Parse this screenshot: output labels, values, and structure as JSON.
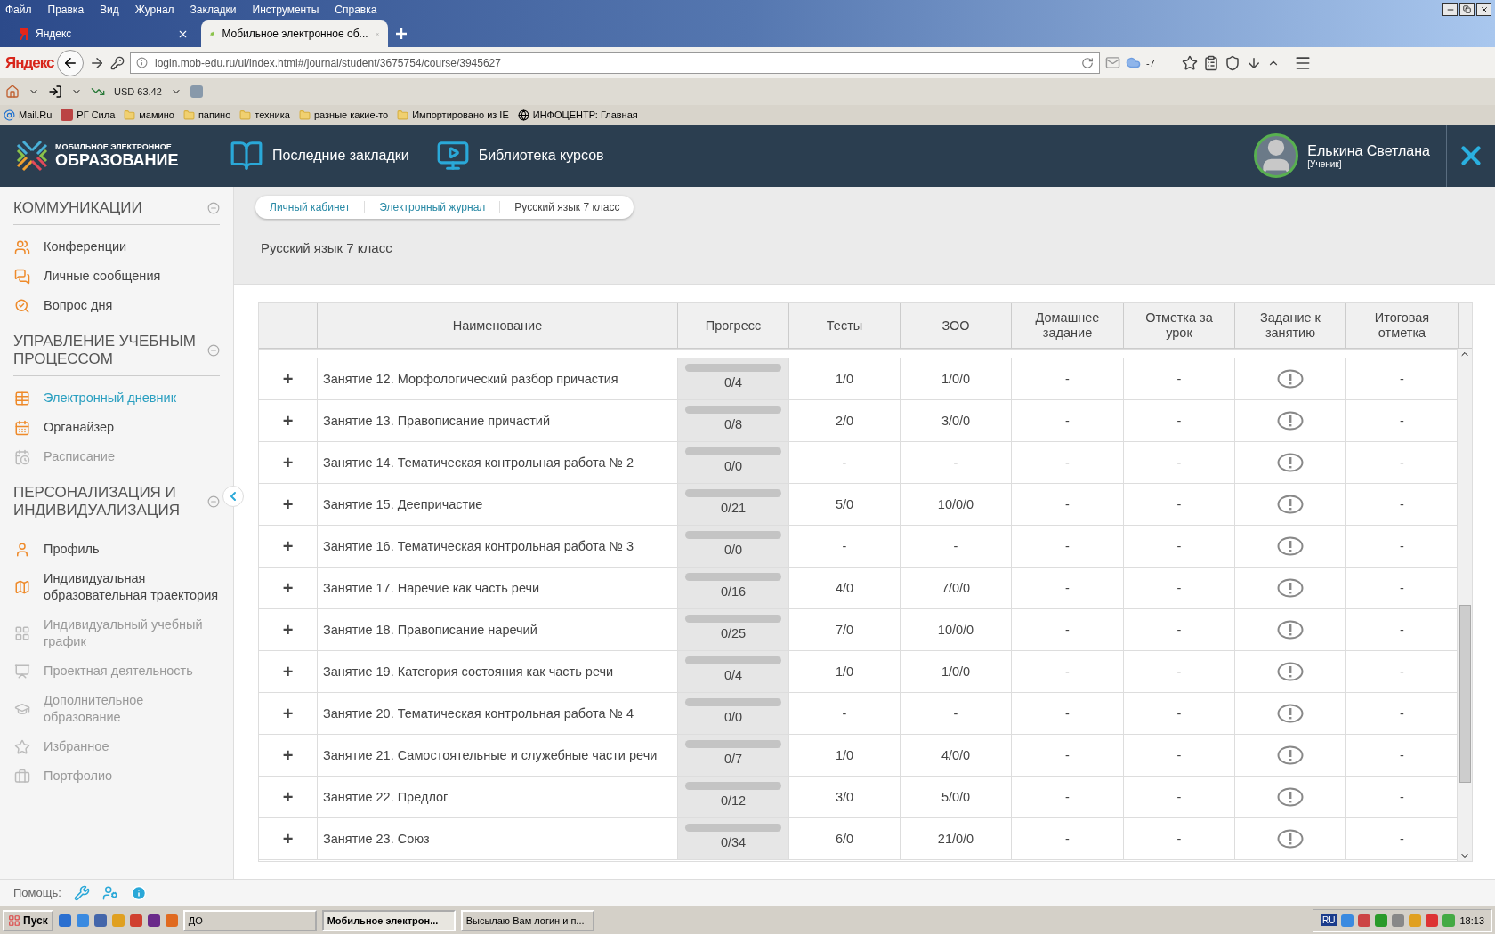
{
  "browser": {
    "menu": [
      "Файл",
      "Правка",
      "Вид",
      "Журнал",
      "Закладки",
      "Инструменты",
      "Справка"
    ],
    "tabs": [
      {
        "label": "Яндекс",
        "selected": false
      },
      {
        "label": "Мобильное электронное об...",
        "selected": true
      }
    ],
    "brand": "Яндекс",
    "address": "login.mob-edu.ru/ui/index.html#/journal/student/3675754/course/3945627",
    "weather": "-7",
    "currency": "USD 63.42",
    "bookmarks": [
      "Mail.Ru",
      "РГ Сила",
      "мамино",
      "папино",
      "техника",
      "разные какие-то",
      "Импортировано из IE",
      "ИНФОЦЕНТР: Главная"
    ]
  },
  "header": {
    "logo_top": "МОБИЛЬНОЕ ЭЛЕКТРОННОЕ",
    "logo_bottom": "ОБРАЗОВАНИЕ",
    "nav": [
      "Последние закладки",
      "Библиотека курсов"
    ],
    "user": {
      "name": "Елькина Светлана",
      "role": "[Ученик]"
    }
  },
  "sidebar": [
    {
      "title": "КОММУНИКАЦИИ",
      "expanded": true,
      "items": [
        {
          "label": "Конференции",
          "selected": false,
          "disabled": false
        },
        {
          "label": "Личные сообщения",
          "selected": false,
          "disabled": false
        },
        {
          "label": "Вопрос дня",
          "selected": false,
          "disabled": false
        }
      ]
    },
    {
      "title": "УПРАВЛЕНИЕ УЧЕБНЫМ ПРОЦЕССОМ",
      "expanded": true,
      "items": [
        {
          "label": "Электронный дневник",
          "selected": true,
          "disabled": false
        },
        {
          "label": "Органайзер",
          "selected": false,
          "disabled": false
        },
        {
          "label": "Расписание",
          "selected": false,
          "disabled": true
        }
      ]
    },
    {
      "title": "ПЕРСОНАЛИЗАЦИЯ И ИНДИВИДУАЛИЗАЦИЯ",
      "expanded": true,
      "items": [
        {
          "label": "Профиль",
          "selected": false,
          "disabled": false
        },
        {
          "label": "Индивидуальная образовательная траектория",
          "selected": false,
          "disabled": false
        },
        {
          "label": "Индивидуальный учебный график",
          "selected": false,
          "disabled": true
        },
        {
          "label": "Проектная деятельность",
          "selected": false,
          "disabled": true
        },
        {
          "label": "Дополнительное образование",
          "selected": false,
          "disabled": true
        },
        {
          "label": "Избранное",
          "selected": false,
          "disabled": true
        },
        {
          "label": "Портфолио",
          "selected": false,
          "disabled": true
        }
      ]
    }
  ],
  "breadcrumbs": [
    "Личный кабинет",
    "Электронный журнал",
    "Русский язык 7 класс"
  ],
  "page_title": "Русский язык 7 класс",
  "table": {
    "columns": [
      "Наименование",
      "Прогресс",
      "Тесты",
      "ЗОО",
      "Домашнее задание",
      "Отметка за урок",
      "Задание к занятию",
      "Итоговая отметка"
    ],
    "rows": [
      {
        "expander": "+",
        "lesson": "Занятие 12. Морфологический разбор причастия",
        "progress": "0/4",
        "level": 0,
        "tests": "1/0",
        "zoo": "1/0/0",
        "homework": "-",
        "mark": "-",
        "final": "-"
      },
      {
        "expander": "+",
        "lesson": "Занятие 13. Правописание причастий",
        "progress": "0/8",
        "level": 0,
        "tests": "2/0",
        "zoo": "3/0/0",
        "homework": "-",
        "mark": "-",
        "final": "-"
      },
      {
        "expander": "+",
        "lesson": "Занятие 14. Тематическая контрольная работа № 2",
        "progress": "0/0",
        "level": 0,
        "tests": "-",
        "zoo": "-",
        "homework": "-",
        "mark": "-",
        "final": "-"
      },
      {
        "expander": "+",
        "lesson": "Занятие 15. Деепричастие",
        "progress": "0/21",
        "level": 0,
        "tests": "5/0",
        "zoo": "10/0/0",
        "homework": "-",
        "mark": "-",
        "final": "-"
      },
      {
        "expander": "+",
        "lesson": "Занятие 16. Тематическая контрольная работа № 3",
        "progress": "0/0",
        "level": 0,
        "tests": "-",
        "zoo": "-",
        "homework": "-",
        "mark": "-",
        "final": "-"
      },
      {
        "expander": "+",
        "lesson": "Занятие 17. Наречие как часть речи",
        "progress": "0/16",
        "level": 0,
        "tests": "4/0",
        "zoo": "7/0/0",
        "homework": "-",
        "mark": "-",
        "final": "-"
      },
      {
        "expander": "+",
        "lesson": "Занятие 18. Правописание наречий",
        "progress": "0/25",
        "level": 0,
        "tests": "7/0",
        "zoo": "10/0/0",
        "homework": "-",
        "mark": "-",
        "final": "-"
      },
      {
        "expander": "+",
        "lesson": "Занятие 19. Категория состояния как часть речи",
        "progress": "0/4",
        "level": 0,
        "tests": "1/0",
        "zoo": "1/0/0",
        "homework": "-",
        "mark": "-",
        "final": "-"
      },
      {
        "expander": "+",
        "lesson": "Занятие 20. Тематическая контрольная работа № 4",
        "progress": "0/0",
        "level": 0,
        "tests": "-",
        "zoo": "-",
        "homework": "-",
        "mark": "-",
        "final": "-"
      },
      {
        "expander": "+",
        "lesson": "Занятие 21. Самостоятельные и служебные части речи",
        "progress": "0/7",
        "level": 0,
        "tests": "1/0",
        "zoo": "4/0/0",
        "homework": "-",
        "mark": "-",
        "final": "-"
      },
      {
        "expander": "+",
        "lesson": "Занятие 22. Предлог",
        "progress": "0/12",
        "level": 0,
        "tests": "3/0",
        "zoo": "5/0/0",
        "homework": "-",
        "mark": "-",
        "final": "-"
      },
      {
        "expander": "+",
        "lesson": "Занятие 23. Союз",
        "progress": "0/34",
        "level": 0,
        "tests": "6/0",
        "zoo": "21/0/0",
        "homework": "-",
        "mark": "-",
        "final": "-"
      }
    ]
  },
  "help": {
    "label": "Помощь:"
  },
  "taskbar": {
    "start": "Пуск",
    "tasks": [
      {
        "label": "ДО",
        "selected": false
      },
      {
        "label": "Мобильное электрон...",
        "selected": true
      },
      {
        "label": "Высылаю Вам логин и п...",
        "selected": false
      }
    ],
    "language": "RU",
    "clock": "18:13"
  }
}
